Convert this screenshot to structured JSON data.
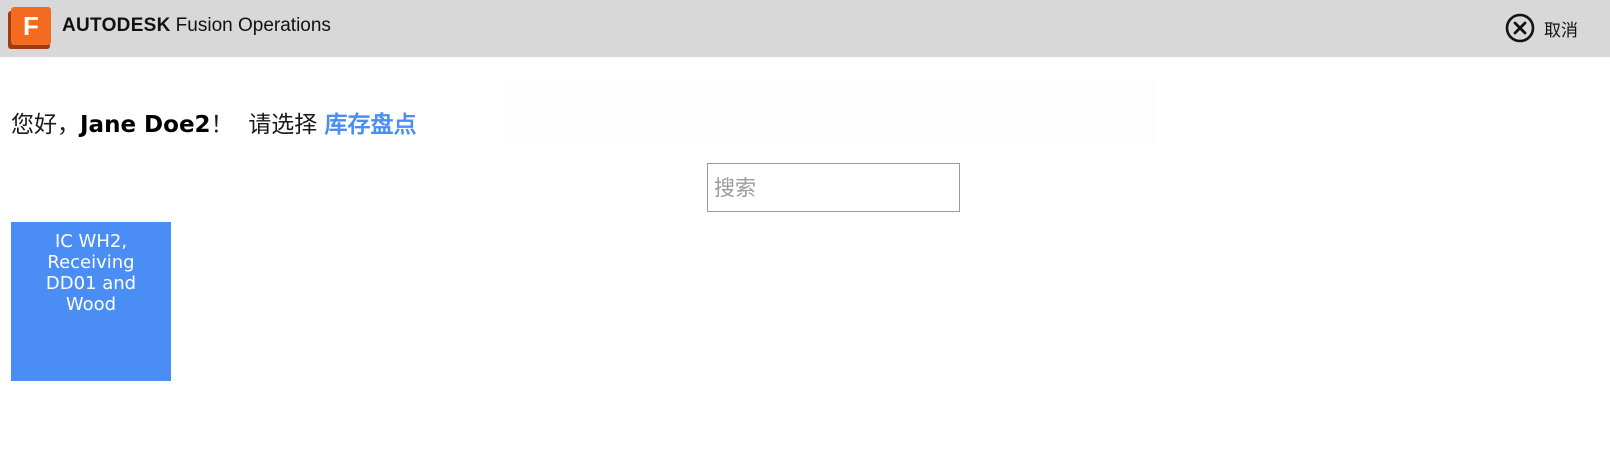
{
  "header": {
    "logo_letter": "F",
    "brand_strong": "AUTODESK",
    "brand_product": "Fusion Operations",
    "cancel_label": "取消",
    "cancel_icon": "close-circle-icon",
    "colors": {
      "bar_bg": "#d8d8d8",
      "logo_orange": "#f26b21",
      "logo_shadow": "#a33a0d"
    }
  },
  "greeting": {
    "hello": "您好，",
    "username": "Jane Doe2",
    "exclaim": "！",
    "prompt": "请选择 ",
    "mode": "库存盘点",
    "accent_color": "#4a8ef5"
  },
  "search": {
    "placeholder": "搜索",
    "value": ""
  },
  "tiles": [
    {
      "label": "IC WH2, Receiving DD01 and Wood",
      "color": "#4a8ef5"
    }
  ]
}
